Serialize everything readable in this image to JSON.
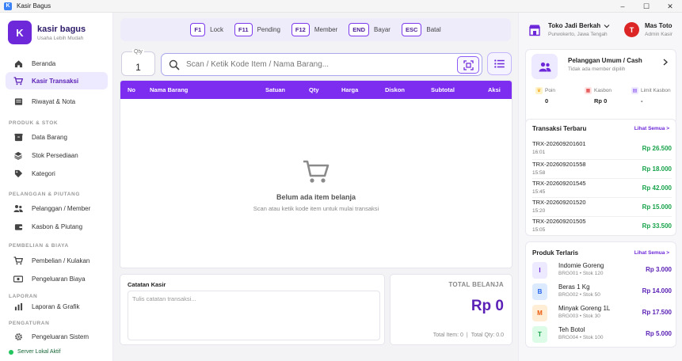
{
  "window": {
    "title": "Kasir Bagus"
  },
  "brand": {
    "logo_letter": "K",
    "name": "kasir bagus",
    "tagline": "Usaha Lebih Mudah"
  },
  "sidebar": {
    "items": [
      {
        "label": "Beranda",
        "icon": "home-icon"
      },
      {
        "label": "Kasir Transaksi",
        "icon": "cart-icon",
        "active": true
      },
      {
        "label": "Riwayat & Nota",
        "icon": "receipt-icon"
      },
      {
        "label": "Data Barang",
        "icon": "box-icon"
      },
      {
        "label": "Stok Persediaan",
        "icon": "layers-icon"
      },
      {
        "label": "Kategori",
        "icon": "tag-icon"
      },
      {
        "label": "Pelanggan / Member",
        "icon": "users-icon"
      },
      {
        "label": "Kasbon & Piutang",
        "icon": "wallet-icon"
      },
      {
        "label": "Pembelian / Kulakan",
        "icon": "truck-icon"
      },
      {
        "label": "Pengeluaran Biaya",
        "icon": "cash-icon"
      },
      {
        "label": "Laporan & Grafik",
        "icon": "chart-icon"
      },
      {
        "label": "Pengeluaran Sistem",
        "icon": "gear-icon"
      }
    ],
    "sections": [
      "PRODUK & STOK",
      "PELANGGAN & PIUTANG",
      "PEMBELIAN & BIAYA",
      "LAPORAN",
      "PENGATURAN"
    ],
    "server_status": "Server Lokal Aktif"
  },
  "shortcuts": [
    {
      "key": "F1",
      "label": "Lock"
    },
    {
      "key": "F11",
      "label": "Pending"
    },
    {
      "key": "F12",
      "label": "Member"
    },
    {
      "key": "END",
      "label": "Bayar"
    },
    {
      "key": "ESC",
      "label": "Batal"
    }
  ],
  "qty": {
    "label": "Qty",
    "value": "1"
  },
  "search": {
    "placeholder": "Scan / Ketik Kode Item / Nama Barang..."
  },
  "table": {
    "headers": [
      "No",
      "Nama Barang",
      "Satuan",
      "Qty",
      "Harga",
      "Diskon",
      "Subtotal",
      "Aksi"
    ],
    "empty_title": "Belum ada item belanja",
    "empty_subtitle": "Scan atau ketik kode item untuk mulai transaksi"
  },
  "notes": {
    "title": "Catatan Kasir",
    "placeholder": "Tulis catatan transaksi..."
  },
  "total": {
    "label": "TOTAL BELANJA",
    "value": "Rp 0",
    "total_item_label": "Total Item: 0",
    "total_qty_label": "Total Qty: 0.0",
    "separator": "|"
  },
  "store": {
    "name": "Toko Jadi Berkah",
    "location": "Purwokerto, Jawa Tengah"
  },
  "user": {
    "initial": "T",
    "name": "Mas Toto",
    "role": "Admin Kasir"
  },
  "customer": {
    "name": "Pelanggan Umum / Cash",
    "note": "Tidak ada member dipilih",
    "stats": [
      {
        "label": "Poin",
        "value": "0",
        "color": "#f59e0b",
        "icon": "crown-icon"
      },
      {
        "label": "Kasbon",
        "value": "Rp 0",
        "color": "#dc2626",
        "icon": "note-icon"
      },
      {
        "label": "Limit Kasbon",
        "value": "-",
        "color": "#7c3aed",
        "icon": "doc-icon"
      }
    ]
  },
  "recent": {
    "title": "Transaksi Terbaru",
    "link": "Lihat Semua >",
    "items": [
      {
        "id": "TRX-202609201601",
        "time": "16:01",
        "amount": "Rp 26.500"
      },
      {
        "id": "TRX-202609201558",
        "time": "15:58",
        "amount": "Rp 18.000"
      },
      {
        "id": "TRX-202609201545",
        "time": "15:45",
        "amount": "Rp 42.000"
      },
      {
        "id": "TRX-202609201520",
        "time": "15:20",
        "amount": "Rp 15.000"
      },
      {
        "id": "TRX-202609201505",
        "time": "15:05",
        "amount": "Rp 33.500"
      }
    ]
  },
  "bestsellers": {
    "title": "Produk Terlaris",
    "link": "Lihat Semua >",
    "items": [
      {
        "initial": "I",
        "name": "Indomie Goreng",
        "sub": "BRG001 • Stok 120",
        "price": "Rp 3.000",
        "bg": "#ede9fe",
        "fg": "#6d28d9"
      },
      {
        "initial": "B",
        "name": "Beras 1 Kg",
        "sub": "BRG002 • Stok 50",
        "price": "Rp 14.000",
        "bg": "#dbeafe",
        "fg": "#2563eb"
      },
      {
        "initial": "M",
        "name": "Minyak Goreng 1L",
        "sub": "BRG003 • Stok 30",
        "price": "Rp 17.500",
        "bg": "#ffedd5",
        "fg": "#ea580c"
      },
      {
        "initial": "T",
        "name": "Teh Botol",
        "sub": "BRG004 • Stok 100",
        "price": "Rp 5.000",
        "bg": "#dcfce7",
        "fg": "#16a34a"
      }
    ]
  },
  "colors": {
    "accent": "#7c2df0",
    "brand": "#6d28d9",
    "positive": "#16a34a"
  }
}
